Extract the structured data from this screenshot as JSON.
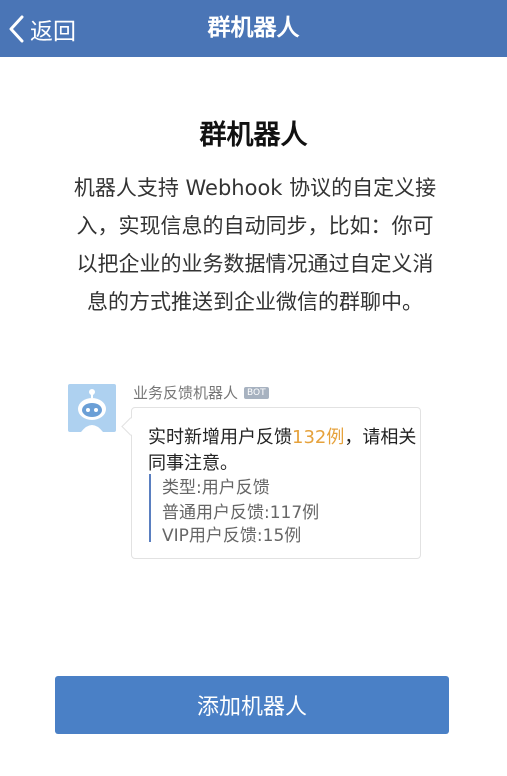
{
  "navbar": {
    "back_label": "返回",
    "title": "群机器人"
  },
  "main": {
    "heading": "群机器人",
    "description_lines": [
      "机器人支持 Webhook 协议的自定义接",
      "入，实现信息的自动同步，比如：你可",
      "以把企业的业务数据情况通过自定义消",
      "息的方式推送到企业微信的群聊中。"
    ]
  },
  "example_message": {
    "sender_name": "业务反馈机器人",
    "badge": "BOT",
    "line1_prefix": "实时新增用户反馈",
    "line1_count": "132例",
    "line1_suffix": "，请相关",
    "line2": "同事注意。",
    "quote_lines": [
      "类型:用户反馈",
      "普通用户反馈:117例",
      "VIP用户反馈:15例"
    ],
    "highlight_color": "#e6a23c"
  },
  "footer": {
    "add_button_label": "添加机器人"
  },
  "colors": {
    "navbar": "#4a75b6",
    "button": "#4a80c6",
    "avatar_bg": "#aed1f0"
  }
}
